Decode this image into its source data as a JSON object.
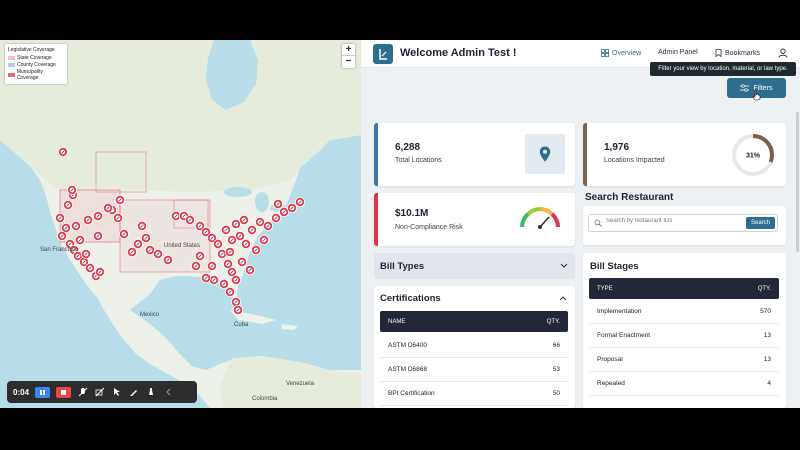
{
  "map": {
    "legend": {
      "title": "Legislative Coverage",
      "items": [
        {
          "label": "State Coverage",
          "color": "#f3c2c9"
        },
        {
          "label": "County Coverage",
          "color": "#b9c7ea"
        },
        {
          "label": "Municipality Coverage",
          "color": "#e0677c"
        }
      ]
    },
    "zoom_in": "+",
    "zoom_out": "−",
    "labels": {
      "mexico": "Mexico",
      "cuba": "Cuba",
      "colombia": "Colombia",
      "venezuela": "Venezuela",
      "united_states": "United States",
      "san_francisco": "San Francisco"
    }
  },
  "recorder": {
    "time": "0:04"
  },
  "header": {
    "welcome": "Welcome Admin Test !",
    "nav": [
      {
        "label": "Overview",
        "icon": "grid-icon"
      },
      {
        "label": "Admin Panel",
        "icon": ""
      },
      {
        "label": "Bookmarks",
        "icon": "bookmark-icon"
      }
    ],
    "tooltip": "Filter your view by location, material, or law type.",
    "filters_label": "Filters"
  },
  "stats": {
    "total_locations": {
      "value": "6,288",
      "label": "Total Locations",
      "color": "#3e79a6"
    },
    "locations_impacted": {
      "value": "1,976",
      "label": "Locations Impacted",
      "percent": "31%",
      "ratio": 0.31,
      "color": "#7a634a"
    },
    "non_compliance": {
      "value": "$10.1M",
      "label": "Non-Compliance Risk",
      "color": "#e0344a"
    }
  },
  "search_restaurant": {
    "title": "Search Restaurant",
    "placeholder": "Search by restaurant IDs",
    "button": "Search"
  },
  "bill_types": {
    "title": "Bill Types"
  },
  "certifications": {
    "title": "Certifications",
    "columns": [
      "NAME",
      "QTY."
    ],
    "rows": [
      {
        "name": "ASTM D6400",
        "qty": "66"
      },
      {
        "name": "ASTM D6868",
        "qty": "53"
      },
      {
        "name": "BPI Certification",
        "qty": "50"
      }
    ]
  },
  "bill_stages": {
    "title": "Bill Stages",
    "columns": [
      "TYPE",
      "QTY."
    ],
    "rows": [
      {
        "type": "Implementation",
        "qty": "570"
      },
      {
        "type": "Formal Enactment",
        "qty": "13"
      },
      {
        "type": "Proposal",
        "qty": "13"
      },
      {
        "type": "Repealed",
        "qty": "4"
      }
    ]
  },
  "colors": {
    "accent": "#2d6e8e",
    "marker": "#e03a4e",
    "dark_header": "#232838"
  }
}
